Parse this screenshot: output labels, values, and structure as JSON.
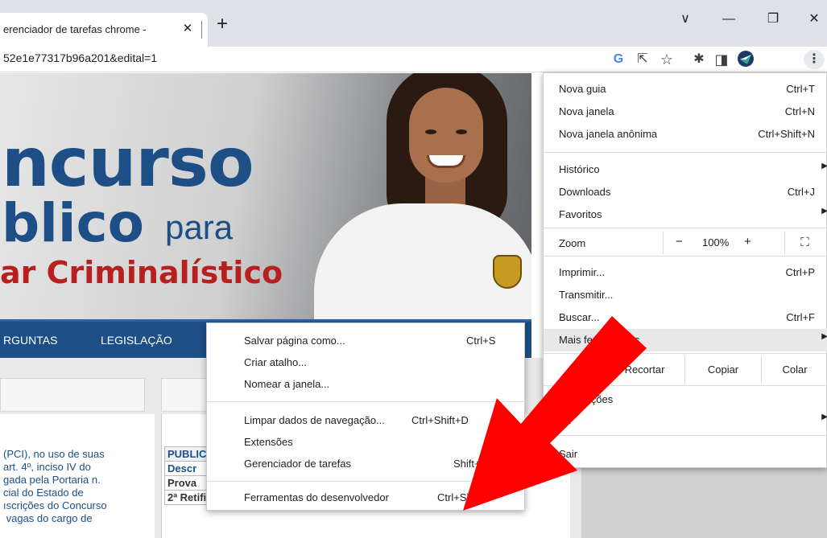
{
  "tab": {
    "title": "erenciador de tarefas chrome - ",
    "close": "✕",
    "new_tab": "+"
  },
  "window": {
    "minimize": "—",
    "restore": "❐",
    "close": "✕",
    "tab_search": "∨"
  },
  "address": {
    "url": "52e1e77317b96a201&edital=1"
  },
  "toolbar_icons": [
    "google-icon",
    "share-icon",
    "star-icon",
    "extensions-icon",
    "sidepanel-icon",
    "profile-icon",
    "kebab-menu-icon"
  ],
  "toolbar": {
    "google": "G",
    "share": "⇱",
    "star": "☆",
    "ext": "✱",
    "side": "◨",
    "more": "⋮"
  },
  "banner": {
    "line1": "ncurso",
    "line2": "blico",
    "line2_small": "para",
    "line3": "ar Criminalístico",
    "title_color": "#1d4e86",
    "accent_color": "#b8201f"
  },
  "nav": {
    "item1": "RGUNTAS",
    "item2": "LEGISLAÇÃO"
  },
  "page": {
    "left_text": "(PCI), no uso de suas\nart. 4º, inciso IV do\ngada pela Portaria n.\ncial do Estado de\nıscrições do Concurso\n vagas do cargo de",
    "table": {
      "head": "PUBLIC",
      "sub": "Descr",
      "row1": "Prova",
      "row2": "2ª Retificação do Resultado dos Recursos"
    }
  },
  "menu": {
    "items": [
      {
        "label": "Nova guia",
        "shortcut": "Ctrl+T"
      },
      {
        "label": "Nova janela",
        "shortcut": "Ctrl+N"
      },
      {
        "label": "Nova janela anônima",
        "shortcut": "Ctrl+Shift+N"
      },
      {
        "label": "Histórico",
        "shortcut": ""
      },
      {
        "label": "Downloads",
        "shortcut": "Ctrl+J"
      },
      {
        "label": "Favoritos",
        "shortcut": ""
      },
      {
        "label": "Imprimir...",
        "shortcut": "Ctrl+P"
      },
      {
        "label": "Transmitir...",
        "shortcut": ""
      },
      {
        "label": "Buscar...",
        "shortcut": "Ctrl+F"
      },
      {
        "label": "Mais ferramentas",
        "shortcut": ""
      },
      {
        "label": "nfigurações",
        "shortcut": ""
      },
      {
        "label": "da",
        "shortcut": ""
      },
      {
        "label": "Sair",
        "shortcut": ""
      }
    ],
    "zoom": {
      "label": "Zoom",
      "minus": "−",
      "value": "100%",
      "plus": "+",
      "fullscreen": "⛶"
    },
    "edit": {
      "cut": "Recortar",
      "copy": "Copiar",
      "paste": "Colar"
    },
    "submenu_arrow": "▶"
  },
  "submenu": {
    "items": [
      {
        "label": "Salvar página como...",
        "shortcut": "Ctrl+S"
      },
      {
        "label": "Criar atalho...",
        "shortcut": ""
      },
      {
        "label": "Nomear a janela...",
        "shortcut": ""
      },
      {
        "label": "Limpar dados de navegação...",
        "shortcut": "Ctrl+Shift+D"
      },
      {
        "label": "Extensões",
        "shortcut": ""
      },
      {
        "label": "Gerenciador de tarefas",
        "shortcut": "Shift+Esc"
      },
      {
        "label": "Ferramentas do desenvolvedor",
        "shortcut": "Ctrl+Shift+I"
      }
    ]
  },
  "colors": {
    "arrow": "#ff0000",
    "nav_bg": "#1d4e86",
    "menu_highlight": "#e8e8e8"
  }
}
